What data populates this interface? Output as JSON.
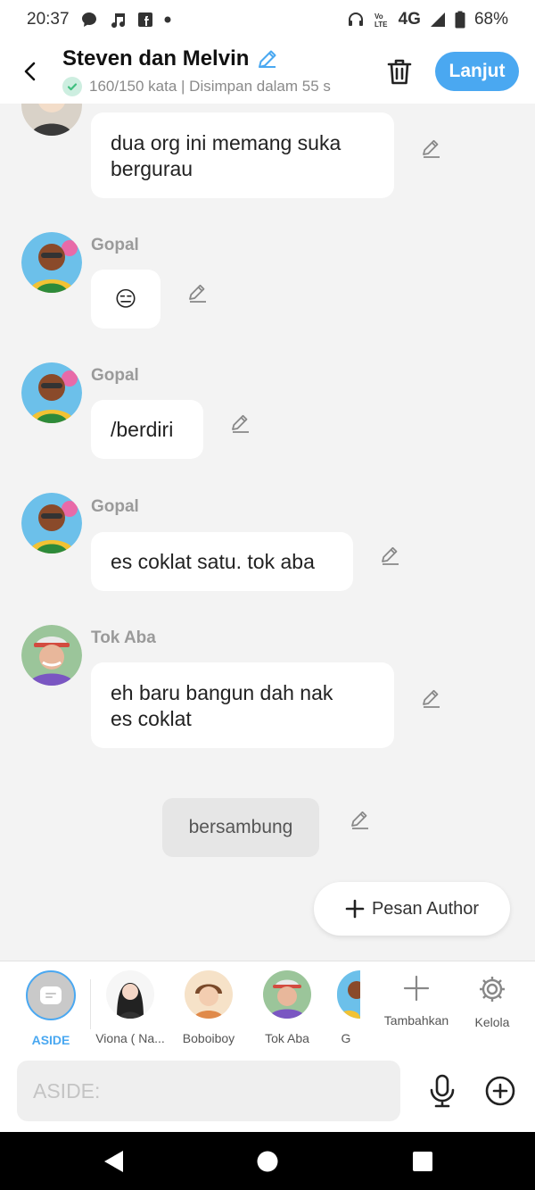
{
  "status_bar": {
    "time": "20:37",
    "network": "4G",
    "battery": "68%",
    "left_icons": [
      "chat-bubble-icon",
      "music-note-icon",
      "facebook-icon",
      "dot-icon"
    ],
    "right_icons": [
      "headphones-icon",
      "volte-icon",
      "signal-icon",
      "battery-icon"
    ]
  },
  "header": {
    "title": "Steven dan Melvin",
    "subtitle": "160/150 kata | Disimpan dalam 55 s",
    "next_label": "Lanjut",
    "accent_color": "#4aa8f1"
  },
  "messages": [
    {
      "sender": "",
      "text": "dua org ini memang suka\nbergurau",
      "avatar": "melvin-avatar"
    },
    {
      "sender": "Gopal",
      "text": "😑",
      "avatar": "gopal-avatar"
    },
    {
      "sender": "Gopal",
      "text": "/berdiri",
      "avatar": "gopal-avatar"
    },
    {
      "sender": "Gopal",
      "text": "es coklat satu. tok aba",
      "avatar": "gopal-avatar"
    },
    {
      "sender": "Tok Aba",
      "text": "eh baru bangun dah nak\nes coklat",
      "avatar": "tok-aba-avatar"
    }
  ],
  "narration": {
    "text": "bersambung"
  },
  "author_button": {
    "label": "Pesan Author"
  },
  "characters": [
    {
      "label": "ASIDE",
      "selected": true
    },
    {
      "label": "Viona ( Na..."
    },
    {
      "label": "Boboiboy"
    },
    {
      "label": "Tok Aba"
    },
    {
      "label": "G"
    }
  ],
  "tools": [
    {
      "label": "Tambahkan",
      "icon": "plus-icon"
    },
    {
      "label": "Kelola",
      "icon": "gear-icon"
    }
  ],
  "input": {
    "placeholder": "ASIDE:"
  }
}
